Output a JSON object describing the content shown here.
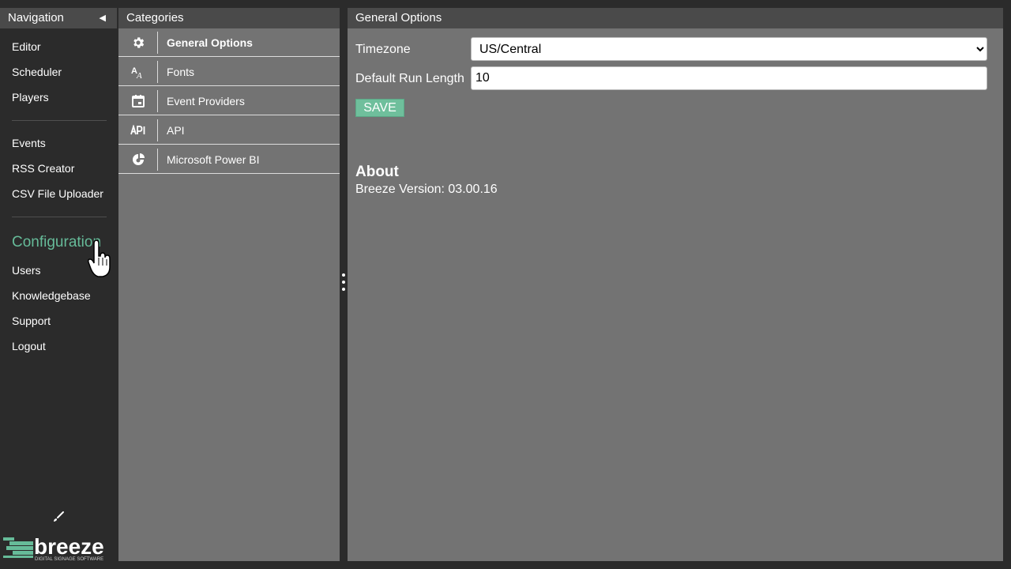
{
  "navigation": {
    "title": "Navigation",
    "items_group1": [
      "Editor",
      "Scheduler",
      "Players"
    ],
    "items_group2": [
      "Events",
      "RSS Creator",
      "CSV File Uploader"
    ],
    "section_title": "Configuration",
    "items_group3": [
      "Users",
      "Knowledgebase",
      "Support",
      "Logout"
    ]
  },
  "logo": {
    "brand": "breeze",
    "tagline": "DIGITAL SIGNAGE SOFTWARE"
  },
  "categories": {
    "title": "Categories",
    "items": [
      {
        "label": "General Options",
        "icon": "gear-icon",
        "active": true
      },
      {
        "label": "Fonts",
        "icon": "font-icon",
        "active": false
      },
      {
        "label": "Event Providers",
        "icon": "calendar-icon",
        "active": false
      },
      {
        "label": "API",
        "icon": "api-icon",
        "active": false
      },
      {
        "label": "Microsoft Power BI",
        "icon": "power-bi-icon",
        "active": false
      }
    ]
  },
  "main": {
    "title": "General Options",
    "timezone_label": "Timezone",
    "timezone_value": "US/Central",
    "run_length_label": "Default Run Length",
    "run_length_value": "10",
    "save_label": "SAVE",
    "about_title": "About",
    "version_text": "Breeze Version: 03.00.16"
  },
  "colors": {
    "accent": "#66bb99",
    "panel": "#737373",
    "header": "#4a4a4a",
    "background": "#2b2b2b"
  }
}
